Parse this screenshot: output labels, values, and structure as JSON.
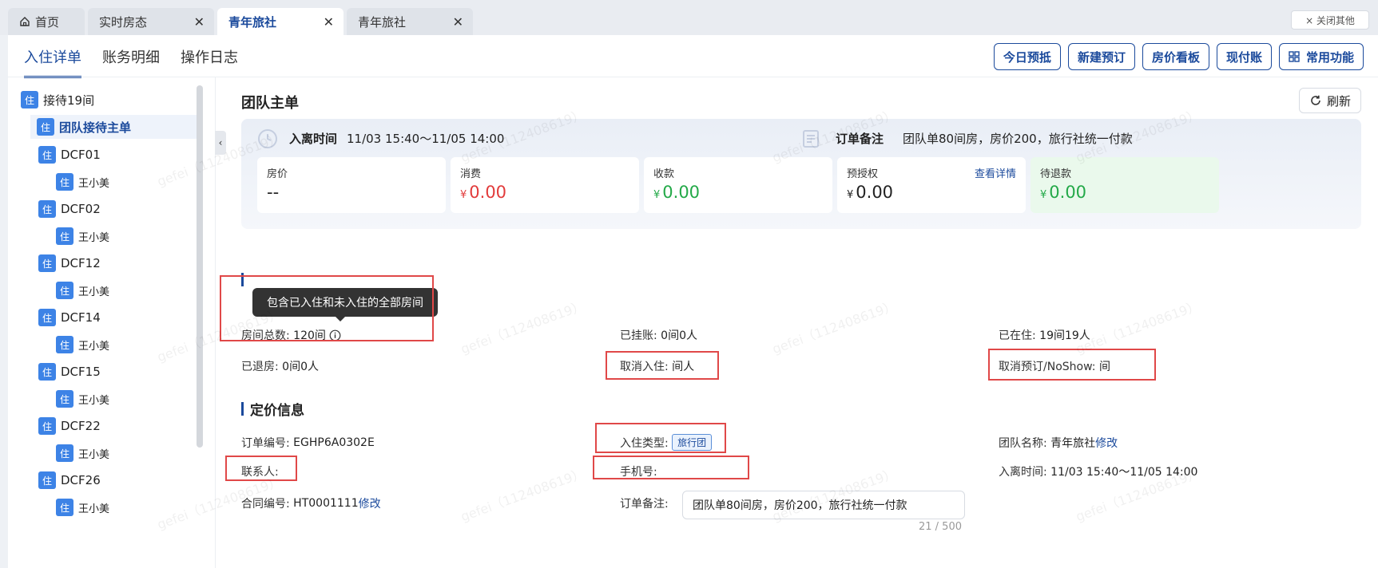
{
  "tabs": [
    {
      "label": "首页",
      "active": false
    },
    {
      "label": "实时房态",
      "active": false
    },
    {
      "label": "青年旅社",
      "active": true
    },
    {
      "label": "青年旅社",
      "active": false
    }
  ],
  "close_others_label": "× 关闭其他",
  "subtabs": [
    "入住详单",
    "账务明细",
    "操作日志"
  ],
  "actions": [
    "今日预抵",
    "新建预订",
    "房价看板",
    "现付账",
    "常用功能"
  ],
  "tree": {
    "badge": "住",
    "root": "接待19间",
    "main": "团队接待主单",
    "rooms": [
      {
        "room": "DCF01",
        "guest": "王小美"
      },
      {
        "room": "DCF02",
        "guest": "王小美"
      },
      {
        "room": "DCF12",
        "guest": "王小美"
      },
      {
        "room": "DCF14",
        "guest": "王小美"
      },
      {
        "room": "DCF15",
        "guest": "王小美"
      },
      {
        "room": "DCF22",
        "guest": "王小美"
      },
      {
        "room": "DCF26",
        "guest": "王小美"
      }
    ]
  },
  "collapse_glyph": "‹",
  "group": {
    "title": "团队主单",
    "refresh_label": "刷新",
    "stay_label": "入离时间",
    "stay_value": "11/03 15:40～11/05 14:00",
    "remark_label": "订单备注",
    "remark_value": "团队单80间房，房价200，旅行社统一付款"
  },
  "cards": [
    {
      "label": "房价",
      "currency": "",
      "value": "--",
      "color": "blk",
      "link": ""
    },
    {
      "label": "消费",
      "currency": "¥",
      "value": "0.00",
      "color": "red",
      "link": ""
    },
    {
      "label": "收款",
      "currency": "¥",
      "value": "0.00",
      "color": "grn",
      "link": ""
    },
    {
      "label": "预授权",
      "currency": "¥",
      "value": "0.00",
      "color": "blk",
      "link": "查看详情"
    },
    {
      "label": "待退款",
      "currency": "¥",
      "value": "0.00",
      "color": "grn",
      "link": ""
    }
  ],
  "tooltip": "包含已入住和未入住的全部房间",
  "room_info": {
    "total_label": "房间总数:",
    "total_value": "120间",
    "hung_label": "已挂账:",
    "hung_value": "0间0人",
    "in_label": "已在住:",
    "in_value": "19间19人",
    "out_label": "已退房:",
    "out_value": "0间0人",
    "cancel_in_label": "取消入住:",
    "cancel_in_value": "间人",
    "noshow_label": "取消预订/NoShow:",
    "noshow_value": "间"
  },
  "pricing": {
    "title": "定价信息",
    "order_no_label": "订单编号:",
    "order_no_value": "EGHP6A0302E",
    "checkin_type_label": "入住类型:",
    "checkin_type_value": "旅行团",
    "team_name_label": "团队名称:",
    "team_name_value": "青年旅社",
    "edit_label": "修改",
    "contact_label": "联系人:",
    "phone_label": "手机号:",
    "stay_label": "入离时间:",
    "stay_value": "11/03 15:40～11/05 14:00",
    "contract_label": "合同编号:",
    "contract_value": "HT0001111",
    "remark_label": "订单备注:",
    "remark_value": "团队单80间房，房价200，旅行社统一付款",
    "remark_count": "21 / 500"
  },
  "watermark": "gefei（112408619）",
  "accent_color": "#1b4a9c"
}
